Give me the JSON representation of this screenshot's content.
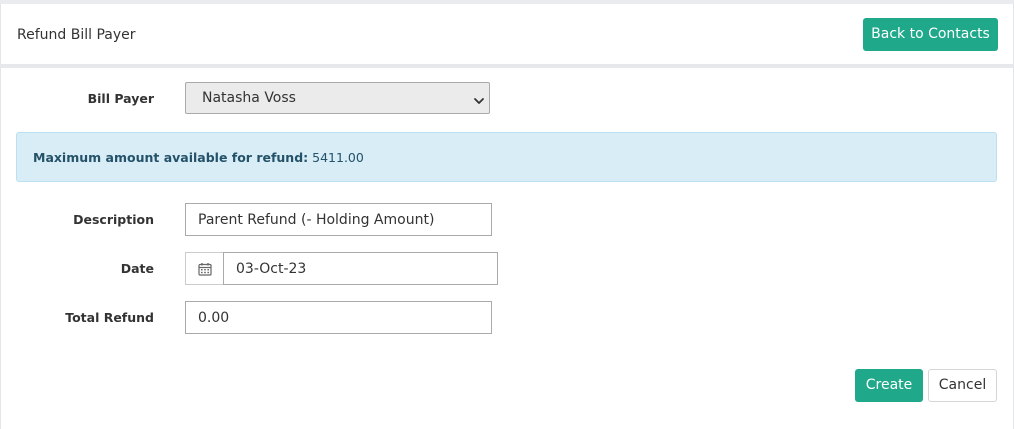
{
  "header": {
    "title": "Refund Bill Payer",
    "back_button_label": "Back to Contacts"
  },
  "form": {
    "bill_payer": {
      "label": "Bill Payer",
      "selected": "Natasha Voss"
    },
    "alert": {
      "label": "Maximum amount available for refund:",
      "value": "5411.00"
    },
    "description": {
      "label": "Description",
      "value": "Parent Refund (- Holding Amount)"
    },
    "date": {
      "label": "Date",
      "value": "03-Oct-23",
      "icon": "calendar-icon"
    },
    "total_refund": {
      "label": "Total Refund",
      "value": "0.00"
    }
  },
  "actions": {
    "create_label": "Create",
    "cancel_label": "Cancel"
  },
  "colors": {
    "primary": "#1fa88a",
    "alert_bg": "#d9edf7",
    "alert_text": "#245269"
  }
}
